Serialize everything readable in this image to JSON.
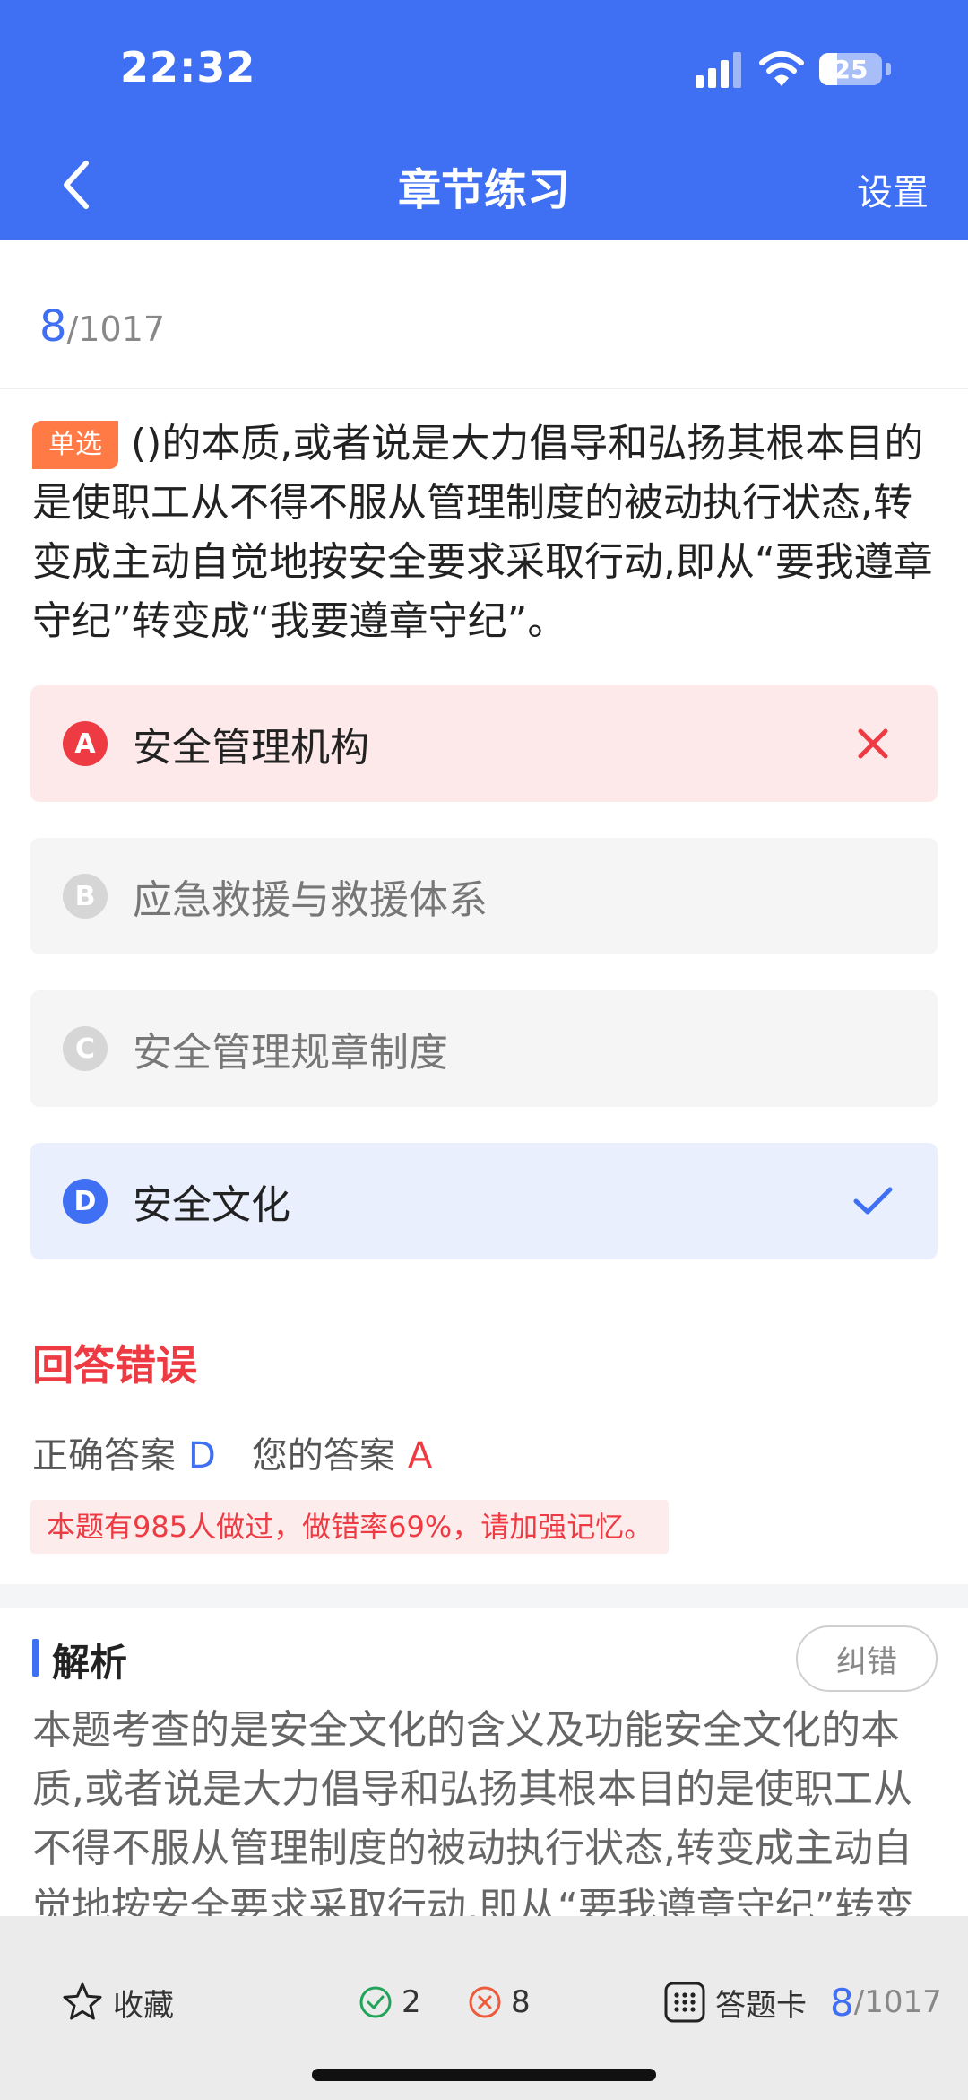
{
  "status_bar": {
    "time": "22:32",
    "battery": "25"
  },
  "nav": {
    "title": "章节练习",
    "settings_label": "设置"
  },
  "progress": {
    "current": "8",
    "total": "/1017"
  },
  "question": {
    "type": "单选",
    "text": "()的本质,或者说是大力倡导和弘扬其根本目的是使职工从不得不服从管理制度的被动执行状态,转变成主动自觉地按安全要求采取行动,即从“要我遵章守纪”转变成“我要遵章守纪”。"
  },
  "options": [
    {
      "letter": "A",
      "text": "安全管理机构",
      "state": "wrong"
    },
    {
      "letter": "B",
      "text": "应急救援与救援体系",
      "state": "neutral"
    },
    {
      "letter": "C",
      "text": "安全管理规章制度",
      "state": "neutral"
    },
    {
      "letter": "D",
      "text": "安全文化",
      "state": "correct"
    }
  ],
  "result": {
    "title": "回答错误",
    "correct_label": "正确答案",
    "correct_value": "D",
    "mine_label": "您的答案",
    "mine_value": "A",
    "stat": "本题有985人做过，做错率69%，请加强记忆。"
  },
  "analysis": {
    "title": "解析",
    "report_label": "纠错",
    "text": "本题考查的是安全文化的含义及功能安全文化的本质,或者说是大力倡导和弘扬其根本目的是使职工从不得不服从管理制度的被动执行状态,转变成主动自觉地按安全要求采取行动,即从“要我遵章守纪”转变成“我要遵章守纪”。"
  },
  "bottom_bar": {
    "favorite_label": "收藏",
    "right_count": "2",
    "wrong_count": "8",
    "card_label": "答题卡",
    "current": "8",
    "total": "/1017"
  },
  "colors": {
    "primary": "#3f6ff2",
    "error": "#ee3b43",
    "badge": "#ff7a45"
  },
  "icons": [
    "back-arrow-icon",
    "signal-icon",
    "wifi-icon",
    "battery-icon",
    "wrong-x-icon",
    "check-icon",
    "star-icon",
    "check-circle-icon",
    "x-circle-icon",
    "grid-icon"
  ]
}
